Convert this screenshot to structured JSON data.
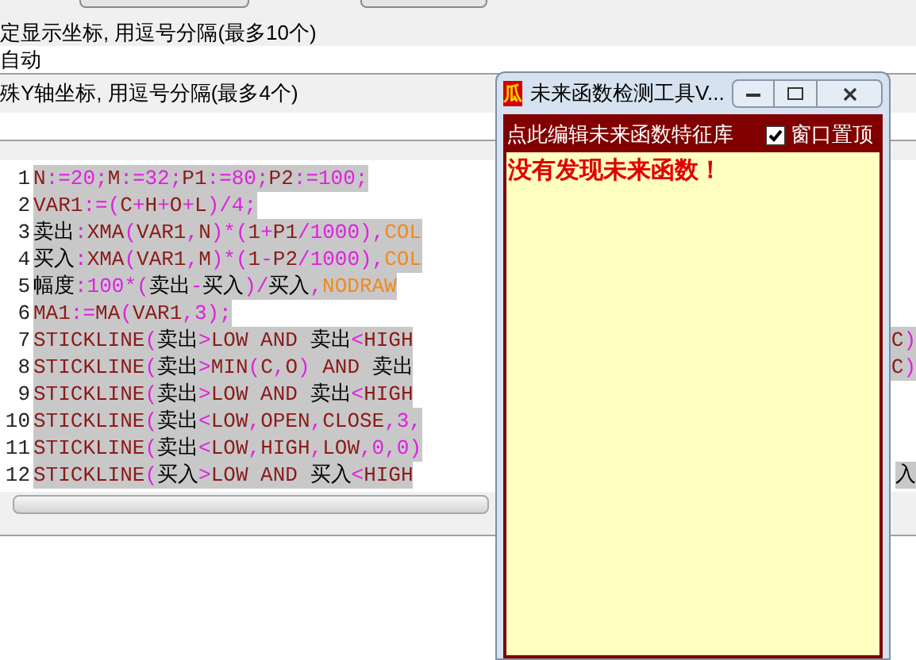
{
  "settings": {
    "axis_label": "定显示坐标, 用逗号分隔(最多10个)",
    "axis_value": "自动",
    "y_axis_label": "殊Y轴坐标, 用逗号分隔(最多4个)"
  },
  "editor": {
    "lines": [
      {
        "number": "1",
        "tokens": [
          {
            "kind": "id",
            "text": "N"
          },
          {
            "kind": "op",
            "text": ":=20;"
          },
          {
            "kind": "id",
            "text": "M"
          },
          {
            "kind": "op",
            "text": ":=32;"
          },
          {
            "kind": "id",
            "text": "P1"
          },
          {
            "kind": "op",
            "text": ":=80;"
          },
          {
            "kind": "id",
            "text": "P2"
          },
          {
            "kind": "op",
            "text": ":=100;"
          }
        ]
      },
      {
        "number": "2",
        "tokens": [
          {
            "kind": "id",
            "text": "VAR1"
          },
          {
            "kind": "op",
            "text": ":=("
          },
          {
            "kind": "id",
            "text": "C"
          },
          {
            "kind": "op",
            "text": "+"
          },
          {
            "kind": "id",
            "text": "H"
          },
          {
            "kind": "op",
            "text": "+"
          },
          {
            "kind": "id",
            "text": "O"
          },
          {
            "kind": "op",
            "text": "+"
          },
          {
            "kind": "id",
            "text": "L"
          },
          {
            "kind": "op",
            "text": ")/4;"
          }
        ]
      },
      {
        "number": "3",
        "tokens": [
          {
            "kind": "cjk",
            "text": "卖出"
          },
          {
            "kind": "op",
            "text": ":"
          },
          {
            "kind": "id",
            "text": "XMA"
          },
          {
            "kind": "op",
            "text": "("
          },
          {
            "kind": "id",
            "text": "VAR1"
          },
          {
            "kind": "op",
            "text": ","
          },
          {
            "kind": "id",
            "text": "N"
          },
          {
            "kind": "op",
            "text": ")*("
          },
          {
            "kind": "id",
            "text": "1"
          },
          {
            "kind": "op",
            "text": "+"
          },
          {
            "kind": "id",
            "text": "P1"
          },
          {
            "kind": "op",
            "text": "/1000),"
          },
          {
            "kind": "const",
            "text": "COL"
          }
        ]
      },
      {
        "number": "4",
        "tokens": [
          {
            "kind": "cjk",
            "text": "买入"
          },
          {
            "kind": "op",
            "text": ":"
          },
          {
            "kind": "id",
            "text": "XMA"
          },
          {
            "kind": "op",
            "text": "("
          },
          {
            "kind": "id",
            "text": "VAR1"
          },
          {
            "kind": "op",
            "text": ","
          },
          {
            "kind": "id",
            "text": "M"
          },
          {
            "kind": "op",
            "text": ")*("
          },
          {
            "kind": "id",
            "text": "1"
          },
          {
            "kind": "op",
            "text": "-"
          },
          {
            "kind": "id",
            "text": "P2"
          },
          {
            "kind": "op",
            "text": "/1000),"
          },
          {
            "kind": "const",
            "text": "COL"
          }
        ]
      },
      {
        "number": "5",
        "tokens": [
          {
            "kind": "cjk",
            "text": "幅度"
          },
          {
            "kind": "op",
            "text": ":100*("
          },
          {
            "kind": "cjk",
            "text": "卖出"
          },
          {
            "kind": "op",
            "text": "-"
          },
          {
            "kind": "cjk",
            "text": "买入"
          },
          {
            "kind": "op",
            "text": ")/"
          },
          {
            "kind": "cjk",
            "text": "买入"
          },
          {
            "kind": "op",
            "text": ","
          },
          {
            "kind": "const",
            "text": "NODRAW"
          }
        ]
      },
      {
        "number": "6",
        "tokens": [
          {
            "kind": "id",
            "text": "MA1"
          },
          {
            "kind": "op",
            "text": ":="
          },
          {
            "kind": "id",
            "text": "MA"
          },
          {
            "kind": "op",
            "text": "("
          },
          {
            "kind": "id",
            "text": "VAR1"
          },
          {
            "kind": "op",
            "text": ",3);"
          }
        ]
      },
      {
        "number": "7",
        "tokens": [
          {
            "kind": "id",
            "text": "STICKLINE"
          },
          {
            "kind": "op",
            "text": "("
          },
          {
            "kind": "cjk",
            "text": "卖出"
          },
          {
            "kind": "op",
            "text": ">"
          },
          {
            "kind": "id",
            "text": "LOW AND "
          },
          {
            "kind": "cjk",
            "text": "卖出"
          },
          {
            "kind": "op",
            "text": "<"
          },
          {
            "kind": "id",
            "text": "HIGH"
          }
        ],
        "tail": [
          {
            "kind": "id",
            "text": "C"
          },
          {
            "kind": "op",
            "text": ")"
          }
        ]
      },
      {
        "number": "8",
        "tokens": [
          {
            "kind": "id",
            "text": "STICKLINE"
          },
          {
            "kind": "op",
            "text": "("
          },
          {
            "kind": "cjk",
            "text": "卖出"
          },
          {
            "kind": "op",
            "text": ">"
          },
          {
            "kind": "id",
            "text": "MIN"
          },
          {
            "kind": "op",
            "text": "("
          },
          {
            "kind": "id",
            "text": "C"
          },
          {
            "kind": "op",
            "text": ","
          },
          {
            "kind": "id",
            "text": "O"
          },
          {
            "kind": "op",
            "text": ")"
          },
          {
            "kind": "id",
            "text": " AND "
          },
          {
            "kind": "cjk",
            "text": "卖出"
          }
        ],
        "tail": [
          {
            "kind": "id",
            "text": "C"
          },
          {
            "kind": "op",
            "text": ")"
          }
        ]
      },
      {
        "number": "9",
        "tokens": [
          {
            "kind": "id",
            "text": "STICKLINE"
          },
          {
            "kind": "op",
            "text": "("
          },
          {
            "kind": "cjk",
            "text": "卖出"
          },
          {
            "kind": "op",
            "text": ">"
          },
          {
            "kind": "id",
            "text": "LOW AND "
          },
          {
            "kind": "cjk",
            "text": "卖出"
          },
          {
            "kind": "op",
            "text": "<"
          },
          {
            "kind": "id",
            "text": "HIGH"
          }
        ]
      },
      {
        "number": "10",
        "tokens": [
          {
            "kind": "id",
            "text": "STICKLINE"
          },
          {
            "kind": "op",
            "text": "("
          },
          {
            "kind": "cjk",
            "text": "卖出"
          },
          {
            "kind": "op",
            "text": "<"
          },
          {
            "kind": "id",
            "text": "LOW"
          },
          {
            "kind": "op",
            "text": ","
          },
          {
            "kind": "id",
            "text": "OPEN"
          },
          {
            "kind": "op",
            "text": ","
          },
          {
            "kind": "id",
            "text": "CLOSE"
          },
          {
            "kind": "op",
            "text": ",3,"
          }
        ]
      },
      {
        "number": "11",
        "tokens": [
          {
            "kind": "id",
            "text": "STICKLINE"
          },
          {
            "kind": "op",
            "text": "("
          },
          {
            "kind": "cjk",
            "text": "卖出"
          },
          {
            "kind": "op",
            "text": "<"
          },
          {
            "kind": "id",
            "text": "LOW"
          },
          {
            "kind": "op",
            "text": ","
          },
          {
            "kind": "id",
            "text": "HIGH"
          },
          {
            "kind": "op",
            "text": ","
          },
          {
            "kind": "id",
            "text": "LOW"
          },
          {
            "kind": "op",
            "text": ",0,0)"
          }
        ]
      },
      {
        "number": "12",
        "tokens": [
          {
            "kind": "id",
            "text": "STICKLINE"
          },
          {
            "kind": "op",
            "text": "("
          },
          {
            "kind": "cjk",
            "text": "买入"
          },
          {
            "kind": "op",
            "text": ">"
          },
          {
            "kind": "id",
            "text": "LOW AND "
          },
          {
            "kind": "cjk",
            "text": "买入"
          },
          {
            "kind": "op",
            "text": "<"
          },
          {
            "kind": "id",
            "text": "HIGH"
          }
        ],
        "tail": [
          {
            "kind": "cjk",
            "text": "入"
          }
        ]
      }
    ]
  },
  "popup": {
    "icon": "瓜",
    "title": "未来函数检测工具V...",
    "feature_link": "点此编辑未来函数特征库",
    "topmost": {
      "label": "窗口置顶",
      "checked": true
    },
    "message": "没有发现未来函数！"
  }
}
